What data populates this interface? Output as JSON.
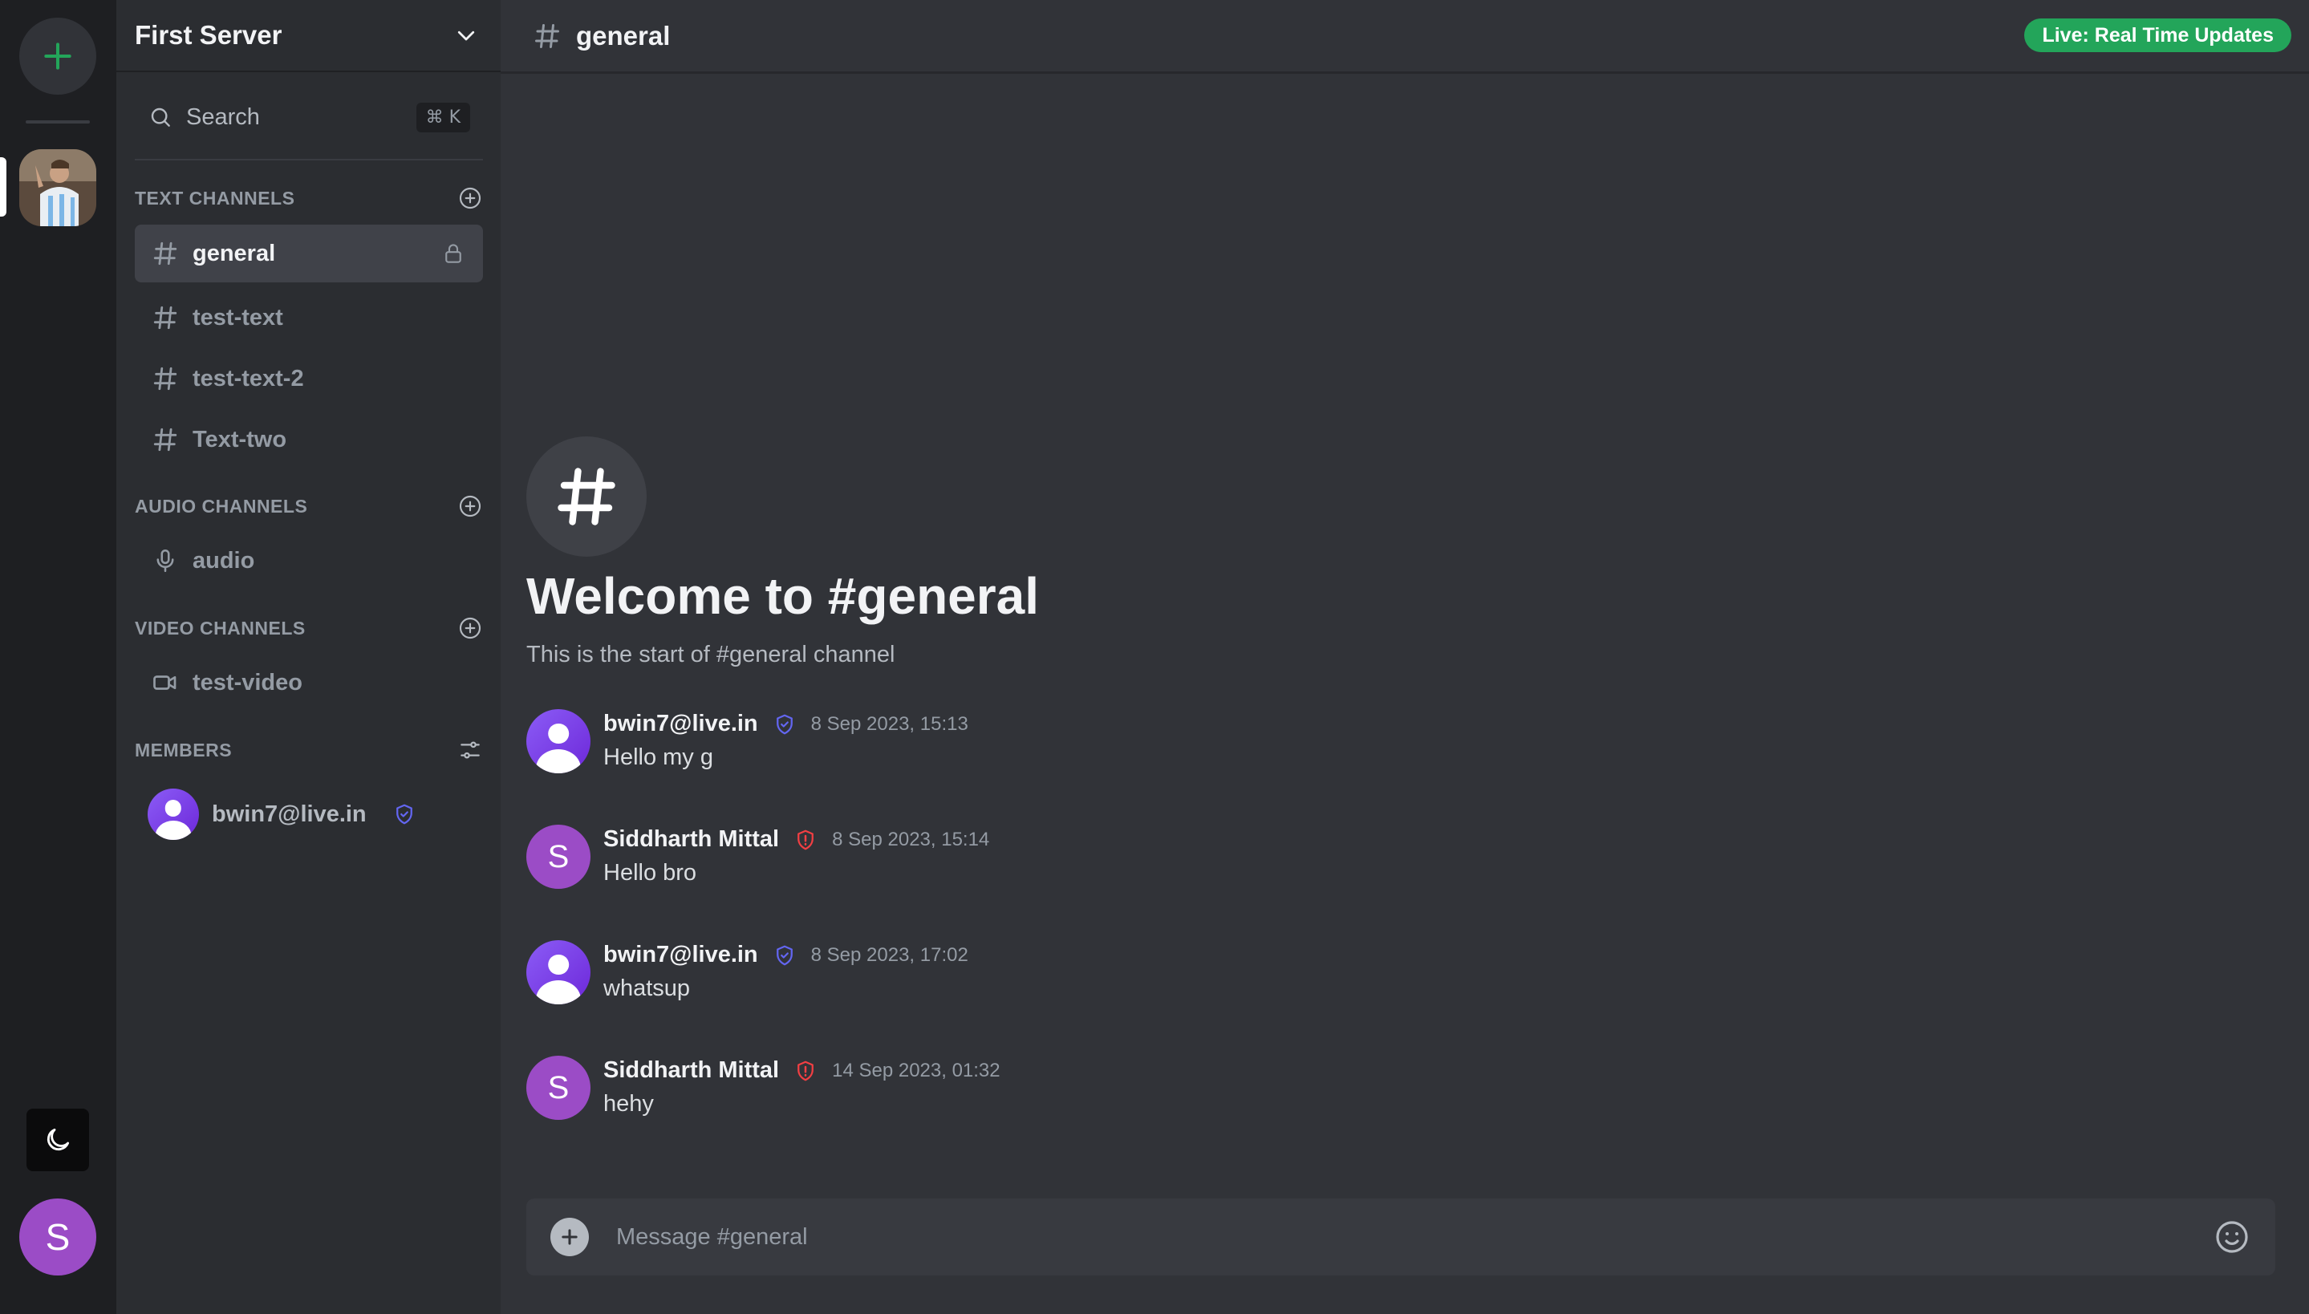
{
  "rail": {
    "add_server_icon": "plus-icon",
    "server_avatar_icon": "server-photo",
    "theme_icon": "moon-icon",
    "user_initial": "S"
  },
  "server": {
    "name": "First Server",
    "menu_icon": "chevron-down-icon"
  },
  "search": {
    "label": "Search",
    "shortcut": "⌘ K"
  },
  "sections": {
    "text": {
      "title": "TEXT CHANNELS"
    },
    "audio": {
      "title": "AUDIO CHANNELS"
    },
    "video": {
      "title": "VIDEO CHANNELS"
    },
    "members": {
      "title": "MEMBERS"
    }
  },
  "text_channels": [
    {
      "name": "general",
      "active": true,
      "locked": true
    },
    {
      "name": "test-text"
    },
    {
      "name": "test-text-2"
    },
    {
      "name": "Text-two"
    }
  ],
  "audio_channels": [
    {
      "name": "audio"
    }
  ],
  "video_channels": [
    {
      "name": "test-video"
    }
  ],
  "members": [
    {
      "name": "bwin7@live.in",
      "role_icon": "shield-check-icon"
    }
  ],
  "chat": {
    "channel": "general",
    "live_badge": "Live: Real Time Updates",
    "welcome_title": "Welcome to #general",
    "welcome_subtitle": "This is the start of #general channel"
  },
  "messages": [
    {
      "author": "bwin7@live.in",
      "role": "moderator",
      "time": "8 Sep 2023, 15:13",
      "text": "Hello my g",
      "avatar": "default"
    },
    {
      "author": "Siddharth Mittal",
      "role": "admin",
      "time": "8 Sep 2023, 15:14",
      "text": "Hello bro",
      "avatar": "S"
    },
    {
      "author": "bwin7@live.in",
      "role": "moderator",
      "time": "8 Sep 2023, 17:02",
      "text": "whatsup",
      "avatar": "default"
    },
    {
      "author": "Siddharth Mittal",
      "role": "admin",
      "time": "14 Sep 2023, 01:32",
      "text": "hehy",
      "avatar": "S"
    }
  ],
  "composer": {
    "placeholder": "Message #general"
  },
  "colors": {
    "accent_green": "#23a55a",
    "moderator_blue": "#6366f1",
    "admin_red": "#f23f43",
    "avatar_purple": "#9b4cc6"
  }
}
